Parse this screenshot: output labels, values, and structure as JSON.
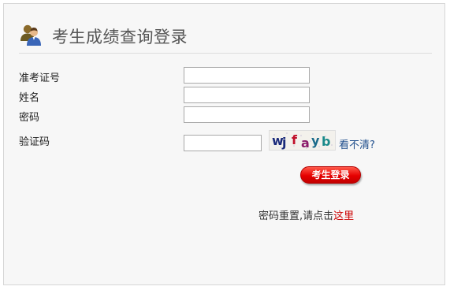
{
  "header": {
    "title": "考生成绩查询登录",
    "icon": "users-icon"
  },
  "form": {
    "exam_id_label": "准考证号",
    "exam_id_value": "",
    "name_label": "姓名",
    "name_value": "",
    "password_label": "密码",
    "password_value": "",
    "captcha_label": "验证码",
    "captcha_value": "",
    "captcha_chars": [
      "w",
      "j",
      "f",
      "a",
      "y",
      "b"
    ],
    "captcha_refresh_label": "看不清?"
  },
  "actions": {
    "login_label": "考生登录"
  },
  "reset": {
    "text": "密码重置,请点击",
    "link_label": "这里"
  },
  "colors": {
    "accent_red": "#e60000",
    "link_blue": "#1f4e8c",
    "reset_link_red": "#cc0000"
  }
}
